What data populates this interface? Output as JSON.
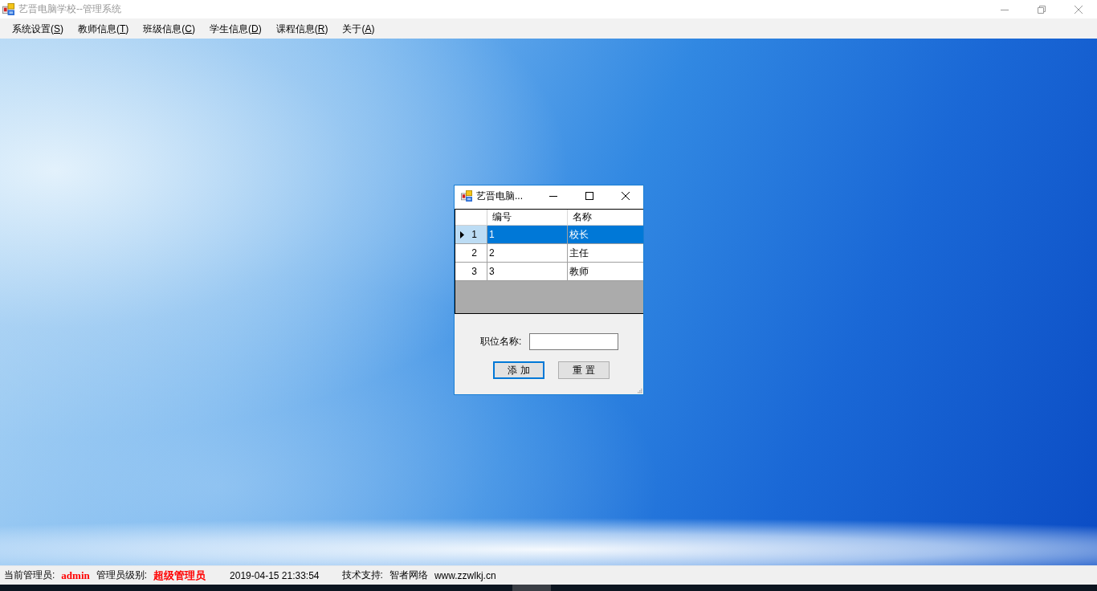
{
  "window": {
    "title": "艺晋电脑学校--管理系统",
    "active": false
  },
  "menu": [
    {
      "before": "系统设置(",
      "key": "S",
      "after": ")"
    },
    {
      "before": "教师信息(",
      "key": "T",
      "after": ")"
    },
    {
      "before": "班级信息(",
      "key": "C",
      "after": ")"
    },
    {
      "before": "学生信息(",
      "key": "D",
      "after": ")"
    },
    {
      "before": "课程信息(",
      "key": "R",
      "after": ")"
    },
    {
      "before": "关于(",
      "key": "A",
      "after": ")"
    }
  ],
  "dialog": {
    "title": "艺晋电脑...",
    "active": true,
    "grid": {
      "columns": [
        "编号",
        "名称"
      ],
      "rows": [
        {
          "number": "1",
          "cells": [
            "1",
            "校长"
          ],
          "selected": true
        },
        {
          "number": "2",
          "cells": [
            "2",
            "主任"
          ],
          "selected": false
        },
        {
          "number": "3",
          "cells": [
            "3",
            "教师"
          ],
          "selected": false
        }
      ]
    },
    "label": "职位名称:",
    "buttons": [
      {
        "label": "添 加",
        "default": true
      },
      {
        "label": "重 置",
        "default": false
      }
    ]
  },
  "status_bar": [
    {
      "text": "当前管理员:",
      "kind": "label"
    },
    {
      "text": "admin",
      "kind": "highlight"
    },
    {
      "text": "管理员级别:",
      "kind": "label"
    },
    {
      "text": "超级管理员",
      "kind": "highlight"
    },
    {
      "text": "2019-04-15 21:33:54",
      "kind": "timestamp"
    },
    {
      "text": "技术支持:",
      "kind": "label"
    },
    {
      "text": "智者网络",
      "kind": "text"
    },
    {
      "text": "www.zzwlkj.cn",
      "kind": "text"
    }
  ]
}
